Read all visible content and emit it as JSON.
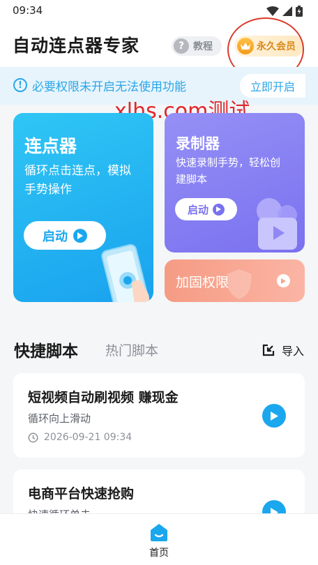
{
  "status_bar": {
    "time": "09:34",
    "icons": [
      "wifi-icon",
      "signal-icon",
      "battery-icon"
    ]
  },
  "header": {
    "title": "自动连点器专家",
    "help_label": "教程",
    "vip_label": "永久会员"
  },
  "notice": {
    "text": "必要权限未开启无法使用功能",
    "button": "立即开启"
  },
  "watermark": "xlhs.com测试",
  "cards": {
    "clicker": {
      "title": "连点器",
      "desc_line1": "循环点击连点，模拟",
      "desc_line2": "手势操作",
      "button": "启动"
    },
    "recorder": {
      "title": "录制器",
      "desc_line1": "快速录制手势，轻松创",
      "desc_line2": "建脚本",
      "button": "启动"
    },
    "permission": {
      "title": "加固权限"
    }
  },
  "tabs": {
    "active": "快捷脚本",
    "inactive": "热门脚本",
    "import": "导入"
  },
  "scripts": [
    {
      "title": "短视频自动刷视频 赚现金",
      "desc": "循环向上滑动",
      "time": "2026-09-21 09:34"
    },
    {
      "title": "电商平台快速抢购",
      "desc": "快速循环单击"
    }
  ],
  "bottom_nav": {
    "home_label": "首页"
  },
  "colors": {
    "accent": "#1aa7ee",
    "recorder": "#8a83f3",
    "permission": "#f7a590",
    "vip": "#f39a1b"
  }
}
